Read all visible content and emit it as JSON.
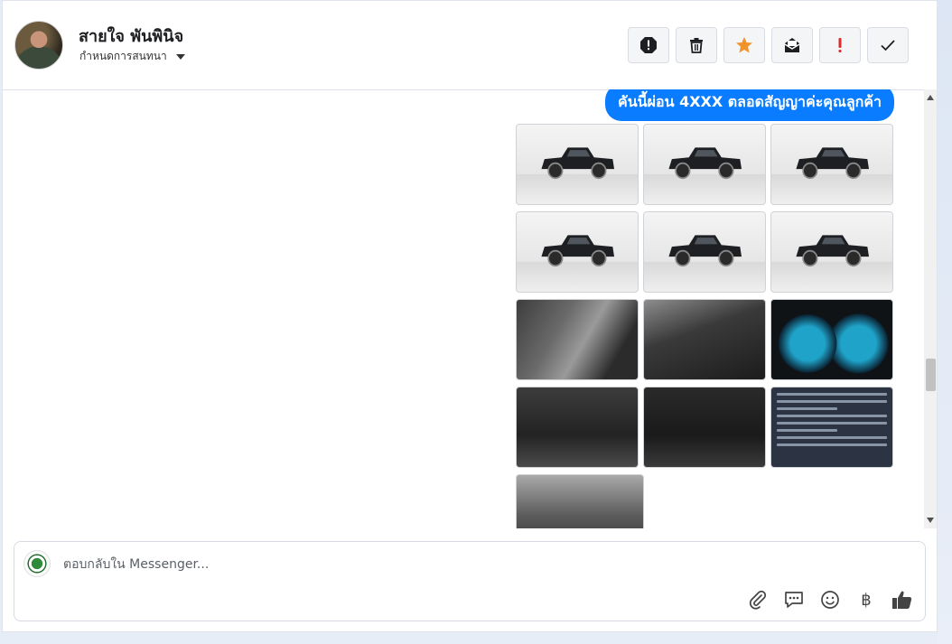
{
  "header": {
    "contact_name": "สายใจ พันพินิจ",
    "assign_label": "กำหนดการสนทนา",
    "actions": [
      {
        "name": "spam-button",
        "icon": "alert-octagon-icon",
        "color": "#1c1e21"
      },
      {
        "name": "delete-button",
        "icon": "trash-icon",
        "color": "#1c1e21"
      },
      {
        "name": "star-button",
        "icon": "star-icon",
        "color": "#f0932b"
      },
      {
        "name": "mark-unread-button",
        "icon": "envelope-open-icon",
        "color": "#1c1e21"
      },
      {
        "name": "flag-important-button",
        "icon": "exclamation-icon",
        "color": "#e02c2c"
      },
      {
        "name": "mark-done-button",
        "icon": "checkmark-icon",
        "color": "#1c1e21"
      }
    ]
  },
  "messages": {
    "outgoing_text": "คันนี้ผ่อน 4XXX ตลอดสัญญาค่ะคุณลูกค้า",
    "bubble_color": "#0a7cff",
    "photos": [
      {
        "kind": "truck-front-left",
        "style": "studio"
      },
      {
        "kind": "truck-front",
        "style": "studio"
      },
      {
        "kind": "truck-rear-left",
        "style": "studio"
      },
      {
        "kind": "truck-rear",
        "style": "studio"
      },
      {
        "kind": "truck-side-right",
        "style": "studio"
      },
      {
        "kind": "truck-side-left",
        "style": "studio"
      },
      {
        "kind": "door-panel",
        "style": "interior-door"
      },
      {
        "kind": "steering-wheel",
        "style": "interior-dash"
      },
      {
        "kind": "gauge-cluster",
        "style": "gauges"
      },
      {
        "kind": "front-console",
        "style": "console"
      },
      {
        "kind": "head-unit",
        "style": "radio"
      },
      {
        "kind": "spec-sheet",
        "style": "spec"
      },
      {
        "kind": "rear-seats",
        "style": "seats"
      }
    ]
  },
  "composer": {
    "placeholder": "ตอบกลับใน Messenger...",
    "icons": [
      "attachment-icon",
      "saved-reply-icon",
      "emoji-icon",
      "baht-payment-icon",
      "thumbs-up-icon"
    ],
    "baht_symbol": "฿"
  }
}
